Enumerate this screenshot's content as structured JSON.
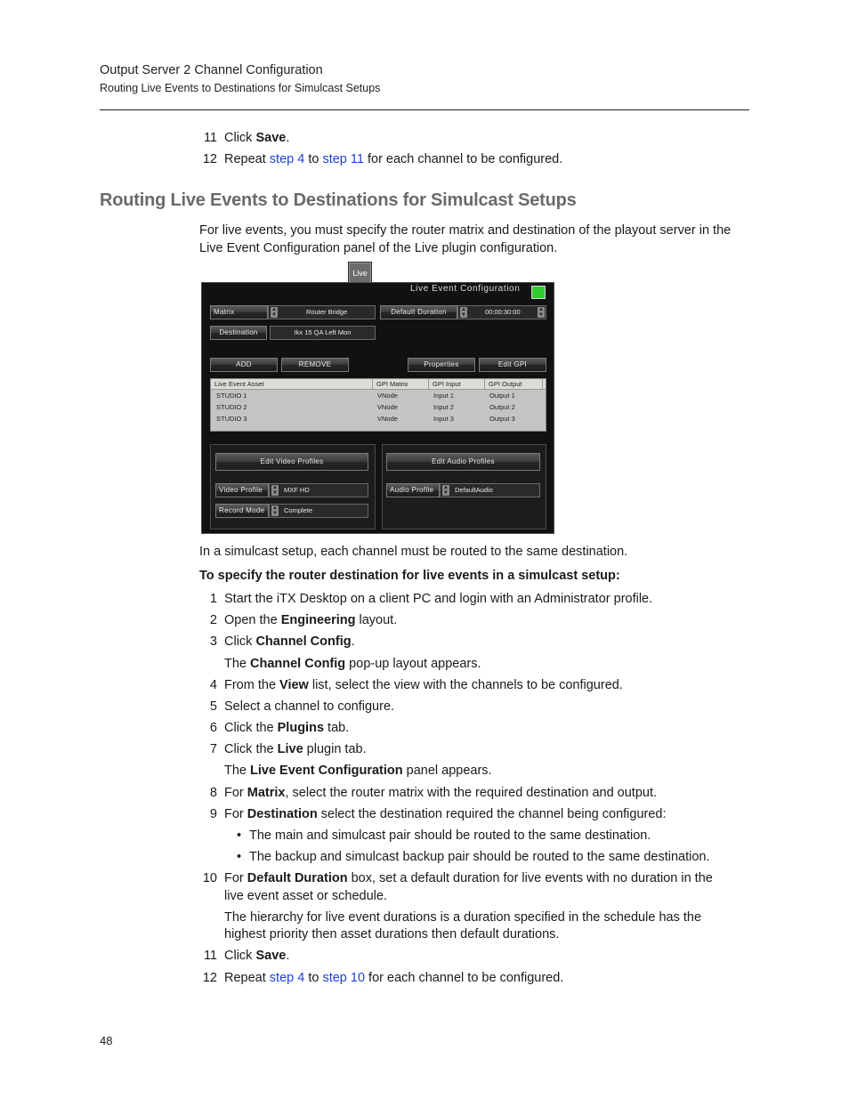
{
  "header": {
    "chapter": "Output Server 2 Channel Configuration",
    "section": "Routing Live Events to Destinations for Simulcast Setups"
  },
  "top_steps": [
    {
      "num": "11",
      "pre": "Click ",
      "bold": "Save",
      "post": "."
    },
    {
      "num": "12",
      "pre": "Repeat ",
      "link1": "step 4",
      "mid": " to ",
      "link2": "step 11",
      "post": " for each channel to be configured."
    }
  ],
  "section_heading": "Routing Live Events to Destinations for Simulcast Setups",
  "intro": "For live events, you must specify the router matrix and destination of the playout server in the Live Event Configuration panel of the Live plugin configuration.",
  "screenshot": {
    "tab_label": "Live",
    "panel_title": "Live Event Configuration",
    "status_color": "#33cc33",
    "matrix_label": "Matrix",
    "matrix_value": "Router Bridge",
    "default_duration_label": "Default Duration",
    "default_duration_value": "00:00:30:00",
    "destination_label": "Destination",
    "destination_value": "Ikx 15 QA Left Mon",
    "add_label": "ADD",
    "remove_label": "REMOVE",
    "properties_label": "Properties",
    "edit_gpi_label": "Edit GPI",
    "table": {
      "columns": [
        "Live Event Asset",
        "GPI Matrix",
        "GPI Input",
        "GPI Output"
      ],
      "rows": [
        [
          "STUDIO 1",
          "VNode",
          "Input 1",
          "Output 1"
        ],
        [
          "STUDIO 2",
          "VNode",
          "Input 2",
          "Output 2"
        ],
        [
          "STUDIO 3",
          "VNode",
          "Input 3",
          "Output 3"
        ]
      ]
    },
    "edit_video_profiles_label": "Edit Video Profiles",
    "video_profile_label": "Video Profile",
    "video_profile_value": "MXF HD",
    "record_mode_label": "Record Mode",
    "record_mode_value": "Complete",
    "edit_audio_profiles_label": "Edit Audio Profiles",
    "audio_profile_label": "Audio Profile",
    "audio_profile_value": "DefaultAudio"
  },
  "simulcast_note": "In a simulcast setup, each channel must be routed to the same destination.",
  "procedure_title": "To specify the router destination for live events in a simulcast setup:",
  "steps": [
    {
      "num": "1",
      "pre": "Start the iTX Desktop on a client PC and login with an Administrator profile.",
      "bold": "",
      "post": ""
    },
    {
      "num": "2",
      "pre": "Open the ",
      "bold": "Engineering",
      "post": " layout."
    },
    {
      "num": "3",
      "pre": "Click ",
      "bold": "Channel Config",
      "post": "."
    },
    {
      "num": "",
      "pre": "The ",
      "bold": "Channel Config",
      "post": " pop-up layout appears."
    },
    {
      "num": "4",
      "pre": "From the ",
      "bold": "View",
      "post": " list, select the view with the channels to be configured."
    },
    {
      "num": "5",
      "pre": "Select a channel to configure.",
      "bold": "",
      "post": ""
    },
    {
      "num": "6",
      "pre": "Click the ",
      "bold": "Plugins",
      "post": " tab."
    },
    {
      "num": "7",
      "pre": "Click the ",
      "bold": "Live",
      "post": " plugin tab."
    },
    {
      "num": "",
      "pre": "The ",
      "bold": "Live Event Configuration",
      "post": " panel appears."
    },
    {
      "num": "8",
      "pre": "For ",
      "bold": "Matrix",
      "post": ", select the router matrix with the required destination and output."
    },
    {
      "num": "9",
      "pre": "For ",
      "bold": "Destination",
      "post": " select the destination required the channel being configured:"
    }
  ],
  "bullets": [
    "The main and simulcast pair should be routed to the same destination.",
    "The backup and simulcast backup pair should be routed to the same destination."
  ],
  "step10": {
    "num": "10",
    "pre": "For ",
    "bold": "Default Duration",
    "post": " box, set a default duration for live events with no duration in the",
    "line2": "live event asset or schedule.",
    "note1": "The hierarchy for live event durations is a duration specified in the schedule has the",
    "note2": "highest priority then asset durations then default durations."
  },
  "end_steps": [
    {
      "num": "11",
      "pre": "Click ",
      "bold": "Save",
      "post": "."
    },
    {
      "num": "12",
      "pre": "Repeat ",
      "link1": "step 4",
      "mid": " to ",
      "link2": "step 10",
      "post": " for each channel to be configured."
    }
  ],
  "page_number": "48"
}
